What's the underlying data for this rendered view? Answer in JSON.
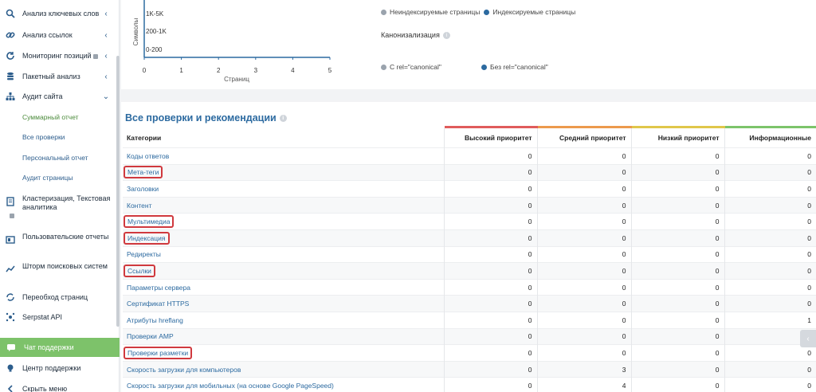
{
  "sidebar": {
    "items": [
      {
        "label": "Анализ ключевых слов",
        "icon": "search-icon",
        "chevron": "‹"
      },
      {
        "label": "Анализ ссылок",
        "icon": "link-icon",
        "chevron": "‹"
      },
      {
        "label": "Мониторинг позиций",
        "icon": "refresh-icon",
        "chevron": "‹"
      },
      {
        "label": "Пакетный анализ",
        "icon": "database-icon",
        "chevron": "‹"
      },
      {
        "label": "Аудит сайта",
        "icon": "sitemap-icon",
        "chevron": "⌄"
      }
    ],
    "sub_items": [
      "Суммарный отчет",
      "Все проверки",
      "Персональный отчет",
      "Аудит страницы"
    ],
    "items2": [
      {
        "label": "Кластеризация, Текстовая аналитика",
        "icon": "document-icon"
      },
      {
        "label": "Пользовательские отчеты",
        "icon": "report-icon"
      },
      {
        "label": "Шторм поисковых систем",
        "icon": "chart-line-icon"
      },
      {
        "label": "Переобход страниц",
        "icon": "recrawl-icon"
      },
      {
        "label": "Serpstat API",
        "icon": "api-icon"
      }
    ],
    "chat": "Чат поддержки",
    "support": "Центр поддержки",
    "hide": "Скрыть меню"
  },
  "top_chart": {
    "ylabel": "Символы",
    "xlabel": "Страниц",
    "y_ticks": [
      "1K-5K",
      "200-1K",
      "0-200"
    ],
    "x_ticks": [
      "0",
      "1",
      "2",
      "3",
      "4",
      "5"
    ],
    "legend": [
      "Неиндексируемые страницы",
      "Индексируемые страницы"
    ],
    "canonical_title": "Канонизализация",
    "canonical_legend": [
      "С rel=\"canonical\"",
      "Без rel=\"canonical\""
    ],
    "colors": {
      "grey": "#9aa3ad",
      "blue": "#2c6aa0"
    }
  },
  "main": {
    "title": "Все проверки и рекомендации",
    "headers": [
      "Категории",
      "Высокий приоритет",
      "Средний приоритет",
      "Низкий приоритет",
      "Информационные"
    ],
    "rows": [
      {
        "cat": "Коды ответов",
        "h": "0",
        "m": "0",
        "l": "0",
        "i": "0",
        "hl": false
      },
      {
        "cat": "Мета-теги",
        "h": "0",
        "m": "0",
        "l": "0",
        "i": "0",
        "hl": true
      },
      {
        "cat": "Заголовки",
        "h": "0",
        "m": "0",
        "l": "0",
        "i": "0",
        "hl": false
      },
      {
        "cat": "Контент",
        "h": "0",
        "m": "0",
        "l": "0",
        "i": "0",
        "hl": false
      },
      {
        "cat": "Мультимедиа",
        "h": "0",
        "m": "0",
        "l": "0",
        "i": "0",
        "hl": true
      },
      {
        "cat": "Индексация",
        "h": "0",
        "m": "0",
        "l": "0",
        "i": "0",
        "hl": true
      },
      {
        "cat": "Редиректы",
        "h": "0",
        "m": "0",
        "l": "0",
        "i": "0",
        "hl": false
      },
      {
        "cat": "Ссылки",
        "h": "0",
        "m": "0",
        "l": "0",
        "i": "0",
        "hl": true
      },
      {
        "cat": "Параметры сервера",
        "h": "0",
        "m": "0",
        "l": "0",
        "i": "0",
        "hl": false
      },
      {
        "cat": "Сертификат HTTPS",
        "h": "0",
        "m": "0",
        "l": "0",
        "i": "0",
        "hl": false
      },
      {
        "cat": "Атрибуты hreflang",
        "h": "0",
        "m": "0",
        "l": "0",
        "i": "1",
        "hl": false
      },
      {
        "cat": "Проверки AMP",
        "h": "0",
        "m": "0",
        "l": "0",
        "i": "1",
        "hl": false
      },
      {
        "cat": "Проверки разметки",
        "h": "0",
        "m": "0",
        "l": "0",
        "i": "0",
        "hl": true
      },
      {
        "cat": "Скорость загрузки для компьютеров",
        "h": "0",
        "m": "3",
        "l": "0",
        "i": "0",
        "hl": false
      },
      {
        "cat": "Скорость загрузки для мобильных (на основе Google PageSpeed)",
        "h": "0",
        "m": "4",
        "l": "0",
        "i": "0",
        "hl": false
      }
    ]
  }
}
